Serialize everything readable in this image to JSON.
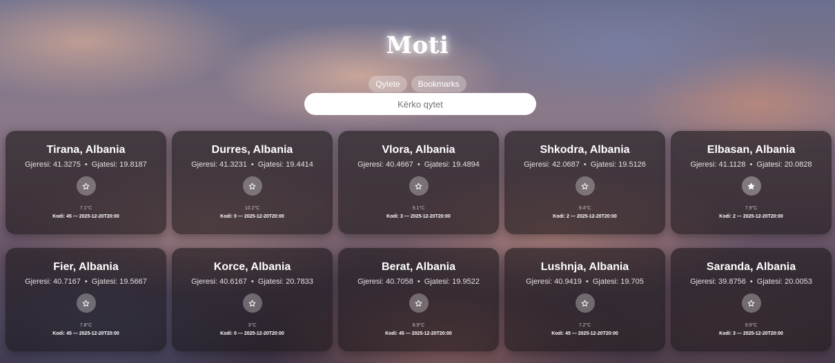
{
  "app": {
    "title": "Moti"
  },
  "nav": {
    "tabs": [
      {
        "label": "Qytete"
      },
      {
        "label": "Bookmarks"
      }
    ]
  },
  "search": {
    "placeholder": "Kërko qytet",
    "value": ""
  },
  "labels": {
    "lat": "Gjeresi:",
    "lon": "Gjatesi:",
    "separator": "•",
    "code": "Kodi:",
    "dash": "—"
  },
  "icons": {
    "bookmark": "star-icon"
  },
  "cities": [
    {
      "name": "Tirana, Albania",
      "lat": "41.3275",
      "lon": "19.8187",
      "temp": "7.1°C",
      "code": "45",
      "time": "2025-12-20T20:00",
      "bookmarked": false
    },
    {
      "name": "Durres, Albania",
      "lat": "41.3231",
      "lon": "19.4414",
      "temp": "10.2°C",
      "code": "0",
      "time": "2025-12-20T20:00",
      "bookmarked": false
    },
    {
      "name": "Vlora, Albania",
      "lat": "40.4667",
      "lon": "19.4894",
      "temp": "9.1°C",
      "code": "3",
      "time": "2025-12-20T20:00",
      "bookmarked": false
    },
    {
      "name": "Shkodra, Albania",
      "lat": "42.0687",
      "lon": "19.5126",
      "temp": "9.4°C",
      "code": "2",
      "time": "2025-12-20T20:00",
      "bookmarked": false
    },
    {
      "name": "Elbasan, Albania",
      "lat": "41.1128",
      "lon": "20.0828",
      "temp": "7.9°C",
      "code": "2",
      "time": "2025-12-20T20:00",
      "bookmarked": true
    },
    {
      "name": "Fier, Albania",
      "lat": "40.7167",
      "lon": "19.5667",
      "temp": "7.8°C",
      "code": "45",
      "time": "2025-12-20T20:00",
      "bookmarked": false
    },
    {
      "name": "Korce, Albania",
      "lat": "40.6167",
      "lon": "20.7833",
      "temp": "3°C",
      "code": "0",
      "time": "2025-12-20T20:00",
      "bookmarked": false
    },
    {
      "name": "Berat, Albania",
      "lat": "40.7058",
      "lon": "19.9522",
      "temp": "8.9°C",
      "code": "45",
      "time": "2025-12-20T20:00",
      "bookmarked": false
    },
    {
      "name": "Lushnja, Albania",
      "lat": "40.9419",
      "lon": "19.705",
      "temp": "7.2°C",
      "code": "45",
      "time": "2025-12-20T20:00",
      "bookmarked": false
    },
    {
      "name": "Saranda, Albania",
      "lat": "39.8756",
      "lon": "20.0053",
      "temp": "9.9°C",
      "code": "3",
      "time": "2025-12-20T20:00",
      "bookmarked": false
    }
  ]
}
